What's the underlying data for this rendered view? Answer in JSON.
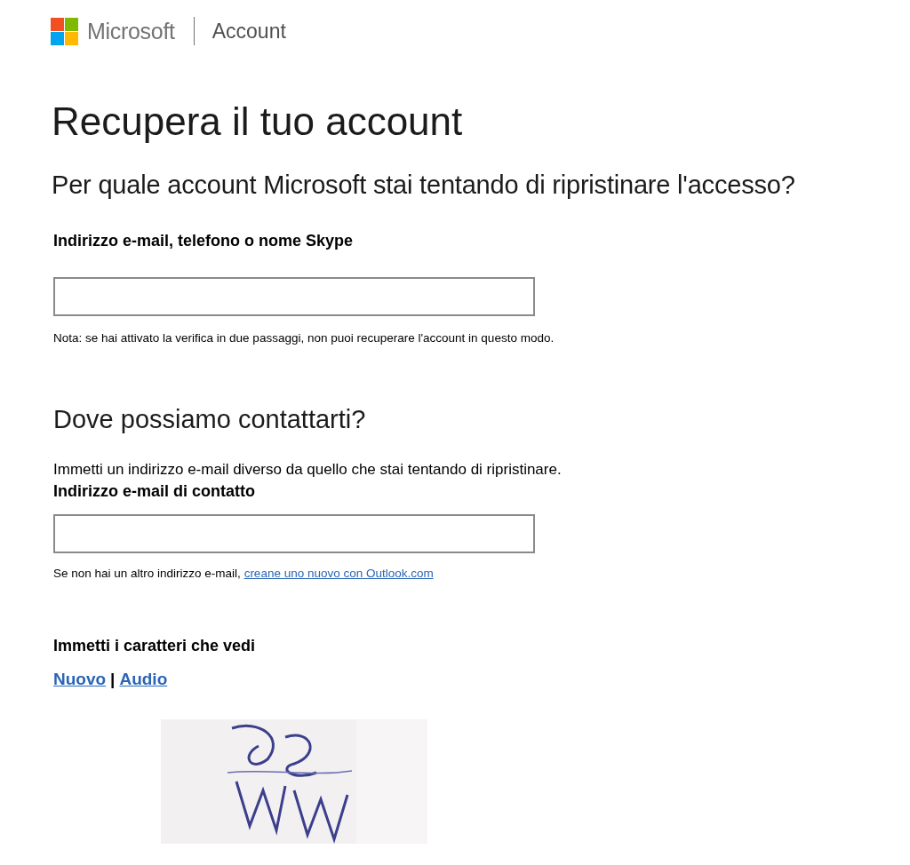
{
  "header": {
    "brand": "Microsoft",
    "section": "Account"
  },
  "title": "Recupera il tuo account",
  "question": "Per quale account Microsoft stai tentando di ripristinare l'accesso?",
  "account_field": {
    "label": "Indirizzo e-mail, telefono o nome Skype",
    "note": "Nota: se hai attivato la verifica in due passaggi, non puoi recuperare l'account in questo modo."
  },
  "contact_section": {
    "heading": "Dove possiamo contattarti?",
    "instructions": "Immetti un indirizzo e-mail diverso da quello che stai tentando di ripristinare.",
    "label": "Indirizzo e-mail di contatto",
    "note": "Se non hai un altro indirizzo e-mail,",
    "link": "creane uno nuovo con Outlook.com"
  },
  "captcha": {
    "label": "Immetti i caratteri che vedi",
    "links": [
      "Nuovo",
      "Audio"
    ],
    "separator": "|"
  }
}
